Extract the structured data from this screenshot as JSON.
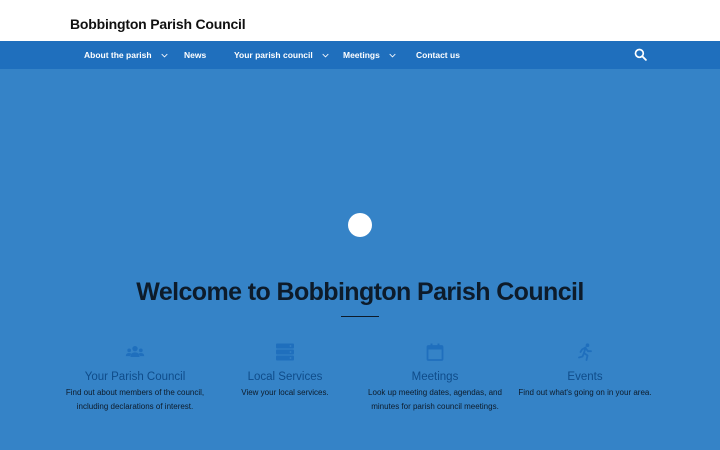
{
  "site": {
    "title": "Bobbington Parish Council"
  },
  "nav": {
    "items": [
      {
        "label": "About the parish",
        "has_dropdown": true
      },
      {
        "label": "News",
        "has_dropdown": false
      },
      {
        "label": "Your parish council",
        "has_dropdown": true
      },
      {
        "label": "Meetings",
        "has_dropdown": true
      },
      {
        "label": "Contact us",
        "has_dropdown": false
      }
    ],
    "search_icon": "search-icon"
  },
  "hero": {
    "heading": "Welcome to Bobbington Parish Council"
  },
  "cards": [
    {
      "icon": "users-icon",
      "title": "Your Parish Council",
      "description": "Find out about members of the council, including declarations of interest."
    },
    {
      "icon": "server-icon",
      "title": "Local Services",
      "description": "View your local services."
    },
    {
      "icon": "calendar-icon",
      "title": "Meetings",
      "description": "Look up meeting dates, agendas, and minutes for parish council meetings."
    },
    {
      "icon": "running-icon",
      "title": "Events",
      "description": "Find out what's going on in your area."
    }
  ],
  "colors": {
    "nav_bg": "#1f6fbd",
    "hero_bg": "#3583c7",
    "card_title": "#0f4c8a",
    "icon": "#1f6fbd"
  }
}
